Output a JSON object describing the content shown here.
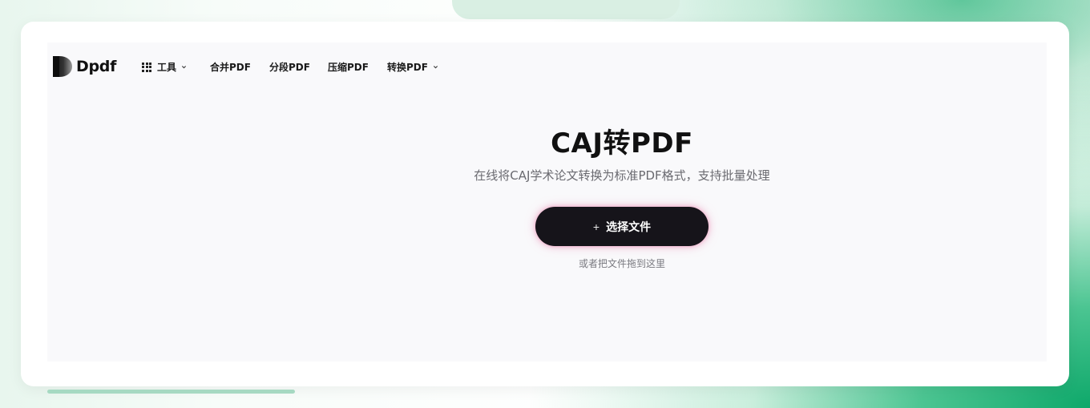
{
  "brand": {
    "name": "Dpdf"
  },
  "nav": {
    "items": [
      {
        "label": "工具",
        "has_dropdown": true,
        "icon": "grid-icon"
      },
      {
        "label": "合并PDF",
        "has_dropdown": false
      },
      {
        "label": "分段PDF",
        "has_dropdown": false
      },
      {
        "label": "压缩PDF",
        "has_dropdown": false
      },
      {
        "label": "转换PDF",
        "has_dropdown": true
      }
    ]
  },
  "hero": {
    "title": "CAJ转PDF",
    "subtitle": "在线将CAJ学术论文转换为标准PDF格式，支持批量处理",
    "upload_button_label": "选择文件",
    "upload_button_icon": "plus-icon",
    "drop_hint": "或者把文件拖到这里"
  },
  "colors": {
    "accent_green": "#0ea86a",
    "button_dark": "#16141a",
    "button_glow": "#eb78aa"
  }
}
